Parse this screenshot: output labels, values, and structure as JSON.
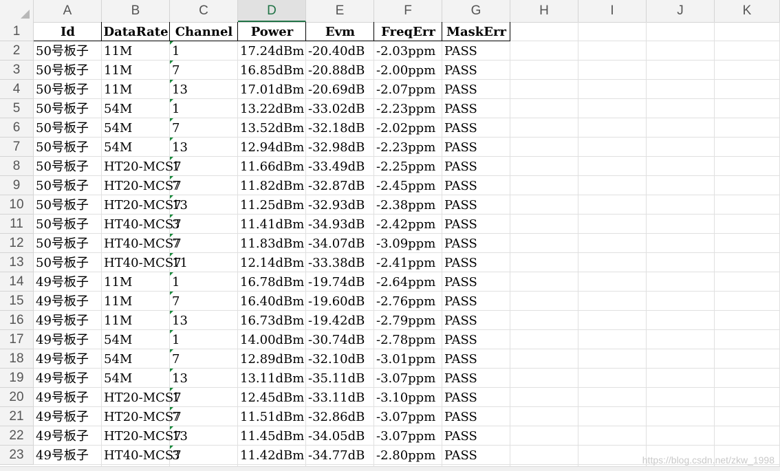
{
  "spreadsheet": {
    "columns": [
      "A",
      "B",
      "C",
      "D",
      "E",
      "F",
      "G",
      "H",
      "I",
      "J",
      "K"
    ],
    "selected_column": "D",
    "header": [
      "Id",
      "DataRate",
      "Channel",
      "Power",
      "Evm",
      "FreqErr",
      "MaskErr"
    ],
    "rows": [
      [
        "50号板子",
        "11M",
        "1",
        "17.24dBm",
        "-20.40dB",
        "-2.03ppm",
        "PASS"
      ],
      [
        "50号板子",
        "11M",
        "7",
        "16.85dBm",
        "-20.88dB",
        "-2.00ppm",
        "PASS"
      ],
      [
        "50号板子",
        "11M",
        "13",
        "17.01dBm",
        "-20.69dB",
        "-2.07ppm",
        "PASS"
      ],
      [
        "50号板子",
        "54M",
        "1",
        "13.22dBm",
        "-33.02dB",
        "-2.23ppm",
        "PASS"
      ],
      [
        "50号板子",
        "54M",
        "7",
        "13.52dBm",
        "-32.18dB",
        "-2.02ppm",
        "PASS"
      ],
      [
        "50号板子",
        "54M",
        "13",
        "12.94dBm",
        "-32.98dB",
        "-2.23ppm",
        "PASS"
      ],
      [
        "50号板子",
        "HT20-MCS7",
        "1",
        "11.66dBm",
        "-33.49dB",
        "-2.25ppm",
        "PASS"
      ],
      [
        "50号板子",
        "HT20-MCS7",
        "7",
        "11.82dBm",
        "-32.87dB",
        "-2.45ppm",
        "PASS"
      ],
      [
        "50号板子",
        "HT20-MCS7",
        "13",
        "11.25dBm",
        "-32.93dB",
        "-2.38ppm",
        "PASS"
      ],
      [
        "50号板子",
        "HT40-MCS7",
        "3",
        "11.41dBm",
        "-34.93dB",
        "-2.42ppm",
        "PASS"
      ],
      [
        "50号板子",
        "HT40-MCS7",
        "7",
        "11.83dBm",
        "-34.07dB",
        "-3.09ppm",
        "PASS"
      ],
      [
        "50号板子",
        "HT40-MCS7",
        "11",
        "12.14dBm",
        "-33.38dB",
        "-2.41ppm",
        "PASS"
      ],
      [
        "49号板子",
        "11M",
        "1",
        "16.78dBm",
        "-19.74dB",
        "-2.64ppm",
        "PASS"
      ],
      [
        "49号板子",
        "11M",
        "7",
        "16.40dBm",
        "-19.60dB",
        "-2.76ppm",
        "PASS"
      ],
      [
        "49号板子",
        "11M",
        "13",
        "16.73dBm",
        "-19.42dB",
        "-2.79ppm",
        "PASS"
      ],
      [
        "49号板子",
        "54M",
        "1",
        "14.00dBm",
        "-30.74dB",
        "-2.78ppm",
        "PASS"
      ],
      [
        "49号板子",
        "54M",
        "7",
        "12.89dBm",
        "-32.10dB",
        "-3.01ppm",
        "PASS"
      ],
      [
        "49号板子",
        "54M",
        "13",
        "13.11dBm",
        "-35.11dB",
        "-3.07ppm",
        "PASS"
      ],
      [
        "49号板子",
        "HT20-MCS7",
        "1",
        "12.45dBm",
        "-33.11dB",
        "-3.10ppm",
        "PASS"
      ],
      [
        "49号板子",
        "HT20-MCS7",
        "7",
        "11.51dBm",
        "-32.86dB",
        "-3.07ppm",
        "PASS"
      ],
      [
        "49号板子",
        "HT20-MCS7",
        "13",
        "11.45dBm",
        "-34.05dB",
        "-3.07ppm",
        "PASS"
      ],
      [
        "49号板子",
        "HT40-MCS7",
        "3",
        "11.42dBm",
        "-34.77dB",
        "-2.80ppm",
        "PASS"
      ]
    ],
    "watermark": "https://blog.csdn.net/zkw_1998",
    "colors": {
      "selected_header": "#217346",
      "error_indicator": "#1a8a3c",
      "gridline": "#e0e0e0"
    }
  }
}
